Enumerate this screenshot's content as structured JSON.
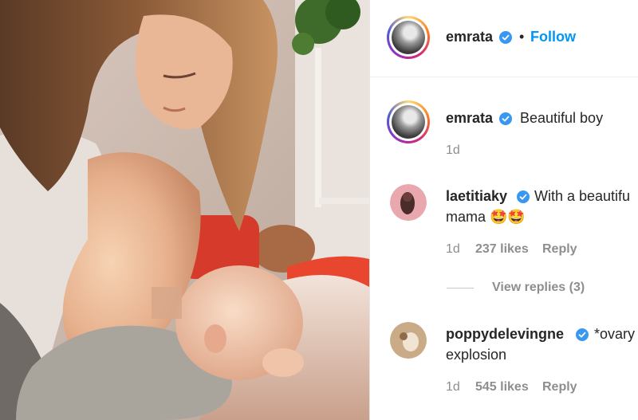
{
  "post": {
    "author": "emrata",
    "follow_label": "Follow",
    "dot": "•"
  },
  "comments": [
    {
      "username": "emrata",
      "text_line1": "Beautiful boy",
      "text_line2": "",
      "time": "1d",
      "likes": "",
      "reply": ""
    },
    {
      "username": "laetitiaky",
      "text_line1": "With a beautifu",
      "text_line2": "mama 🤩🤩",
      "time": "1d",
      "likes": "237 likes",
      "reply": "Reply",
      "view_replies": "View replies (3)"
    },
    {
      "username": "poppydelevingne",
      "text_line1": "*ovary",
      "text_line2": "explosion",
      "time": "1d",
      "likes": "545 likes",
      "reply": "Reply"
    }
  ],
  "colors": {
    "follow": "#0095f6",
    "verified": "#3897f0",
    "meta": "#8e8e8e"
  }
}
